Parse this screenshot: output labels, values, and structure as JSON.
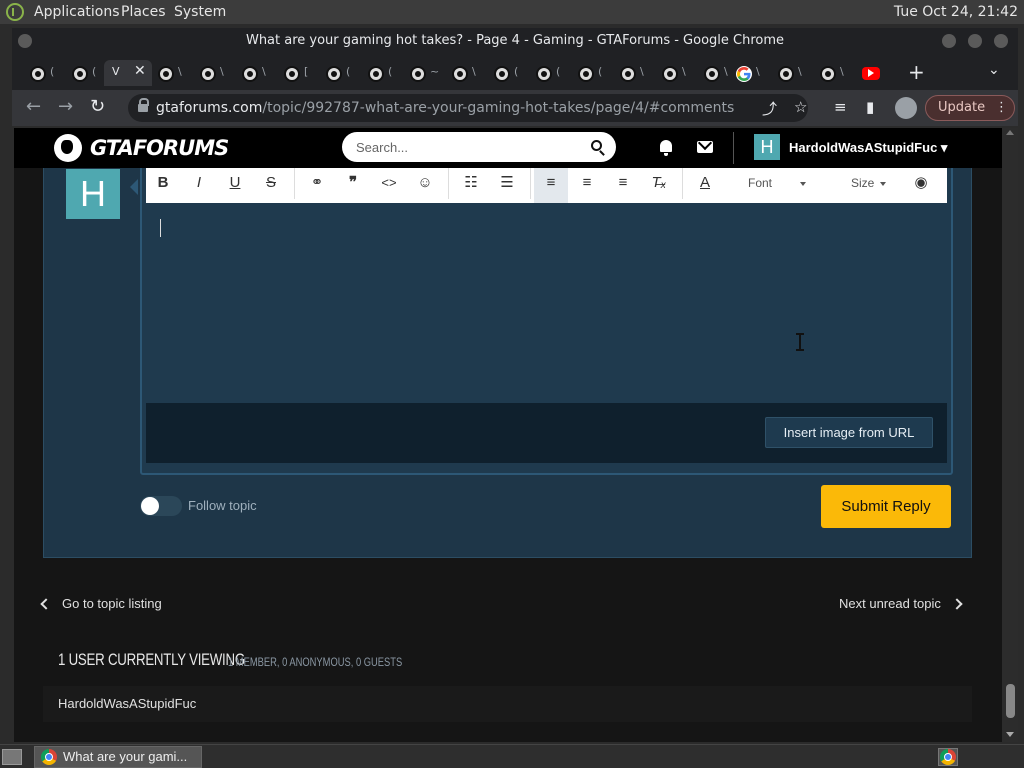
{
  "os": {
    "menu": [
      "Applications",
      "Places",
      "System"
    ],
    "clock": "Tue Oct 24, 21:42"
  },
  "browser": {
    "window_title": "What are your gaming hot takes? - Page 4 - Gaming - GTAForums - Google Chrome",
    "active_tab_char": "V",
    "tab_chars": [
      "(",
      "(",
      "\\",
      "\\",
      "\\",
      "[",
      "(",
      "(",
      "~",
      "\\",
      "(",
      "(",
      "(",
      "\\",
      "\\",
      "\\",
      "\\",
      "\\",
      "\\"
    ],
    "url_host": "gtaforums.com",
    "url_path": "/topic/992787-what-are-your-gaming-hot-takes/page/4/#comments",
    "update_label": "Update"
  },
  "site": {
    "logo_text": "GTAFORUMS",
    "search_placeholder": "Search...",
    "username": "HardoldWasAStupidFuc",
    "avatar_letter": "H"
  },
  "editor": {
    "font_label": "Font",
    "size_label": "Size",
    "insert_image_label": "Insert image from URL"
  },
  "reply": {
    "follow_label": "Follow topic",
    "submit_label": "Submit Reply"
  },
  "nav": {
    "prev_label": "Go to topic listing",
    "next_label": "Next unread topic"
  },
  "viewing": {
    "title": "1 USER CURRENTLY VIEWING",
    "subtitle": "1 MEMBER, 0 ANONYMOUS, 0 GUESTS",
    "users": [
      "HardoldWasAStupidFuc"
    ]
  },
  "taskbar": {
    "item_label": "What are your gami..."
  }
}
